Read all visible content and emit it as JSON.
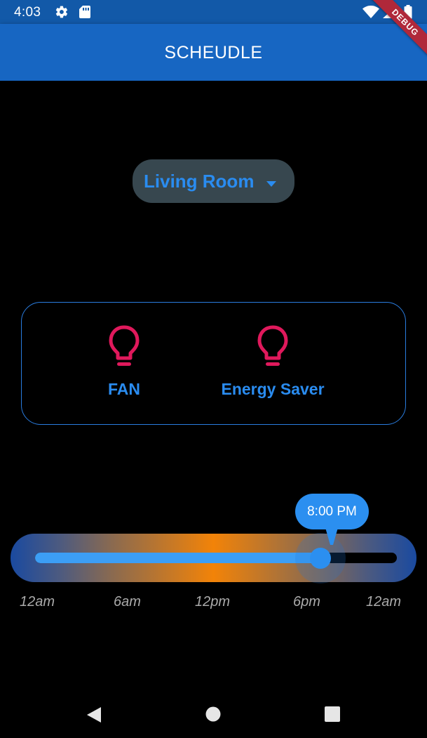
{
  "status_bar": {
    "time": "4:03",
    "icons": [
      "gear-icon",
      "sd-card-icon",
      "wifi-icon",
      "signal-icon",
      "battery-icon"
    ]
  },
  "debug_banner": "DEBUG",
  "app_bar": {
    "title": "SCHEUDLE"
  },
  "room_selector": {
    "selected": "Living Room",
    "icon": "caret-down-icon"
  },
  "devices": [
    {
      "label": "FAN",
      "icon": "lightbulb-icon",
      "icon_color": "#e0195c"
    },
    {
      "label": "Energy Saver",
      "icon": "lightbulb-icon",
      "icon_color": "#e0195c"
    }
  ],
  "time_slider": {
    "value_label": "8:00 PM",
    "value_hours": 20,
    "max_hours": 24,
    "tick_labels": [
      "12am",
      "6am",
      "12pm",
      "6pm",
      "12am"
    ]
  },
  "colors": {
    "app_bar": "#1766c2",
    "status_bar": "#1259a8",
    "accent": "#2a8cf0",
    "bulb": "#e0195c",
    "slider_gradient_center": "#f28308"
  },
  "nav_bar": {
    "icons": [
      "back-icon",
      "home-icon",
      "recents-icon"
    ]
  }
}
